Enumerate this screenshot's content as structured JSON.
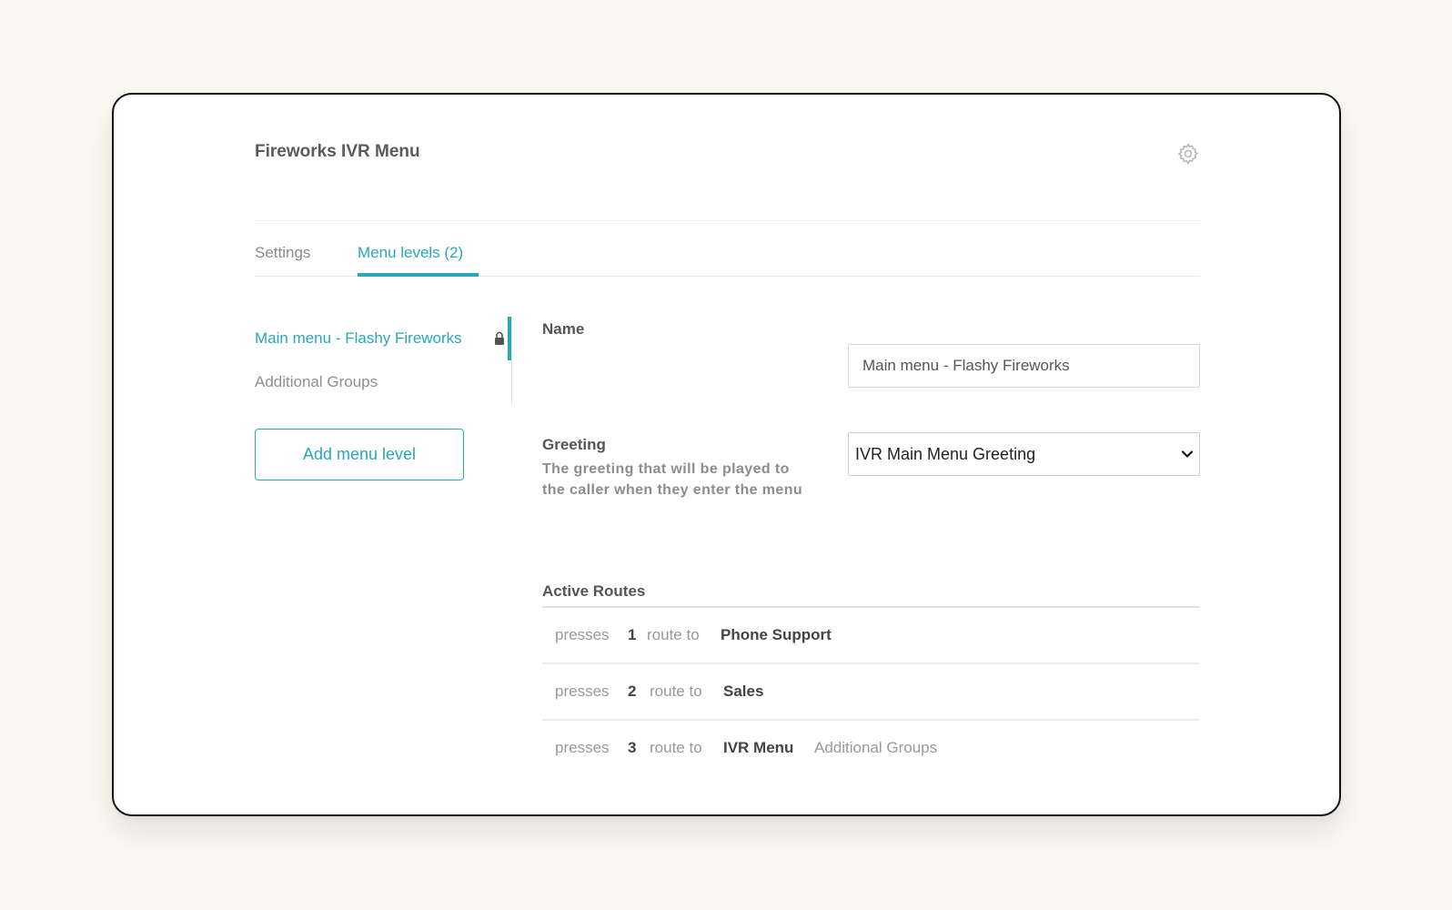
{
  "header": {
    "title": "Fireworks IVR Menu",
    "settings_icon": "gear-icon"
  },
  "tabs": [
    {
      "label": "Settings",
      "active": false
    },
    {
      "label": "Menu levels (2)",
      "active": true
    }
  ],
  "sidebar": {
    "items": [
      {
        "label": "Main menu - Flashy Fireworks",
        "active": true,
        "locked": true,
        "icon": "lock-icon"
      },
      {
        "label": "Additional Groups",
        "active": false
      }
    ],
    "add_button_label": "Add menu level"
  },
  "form": {
    "name": {
      "label": "Name",
      "value": "Main menu - Flashy Fireworks"
    },
    "greeting": {
      "label": "Greeting",
      "help": "The greeting that will be played to the caller when they enter the menu",
      "selected": "IVR Main Menu Greeting"
    },
    "active_routes": {
      "label": "Active Routes",
      "rows": [
        {
          "presses": "presses",
          "key": "1",
          "route_to": "route to",
          "destination": "Phone Support",
          "extra": ""
        },
        {
          "presses": "presses",
          "key": "2",
          "route_to": "route to",
          "destination": "Sales",
          "extra": ""
        },
        {
          "presses": "presses",
          "key": "3",
          "route_to": "route to",
          "destination": "IVR Menu",
          "extra": "Additional Groups"
        }
      ]
    }
  },
  "colors": {
    "accent": "#2aa7b8",
    "background": "#fcf8f2"
  }
}
